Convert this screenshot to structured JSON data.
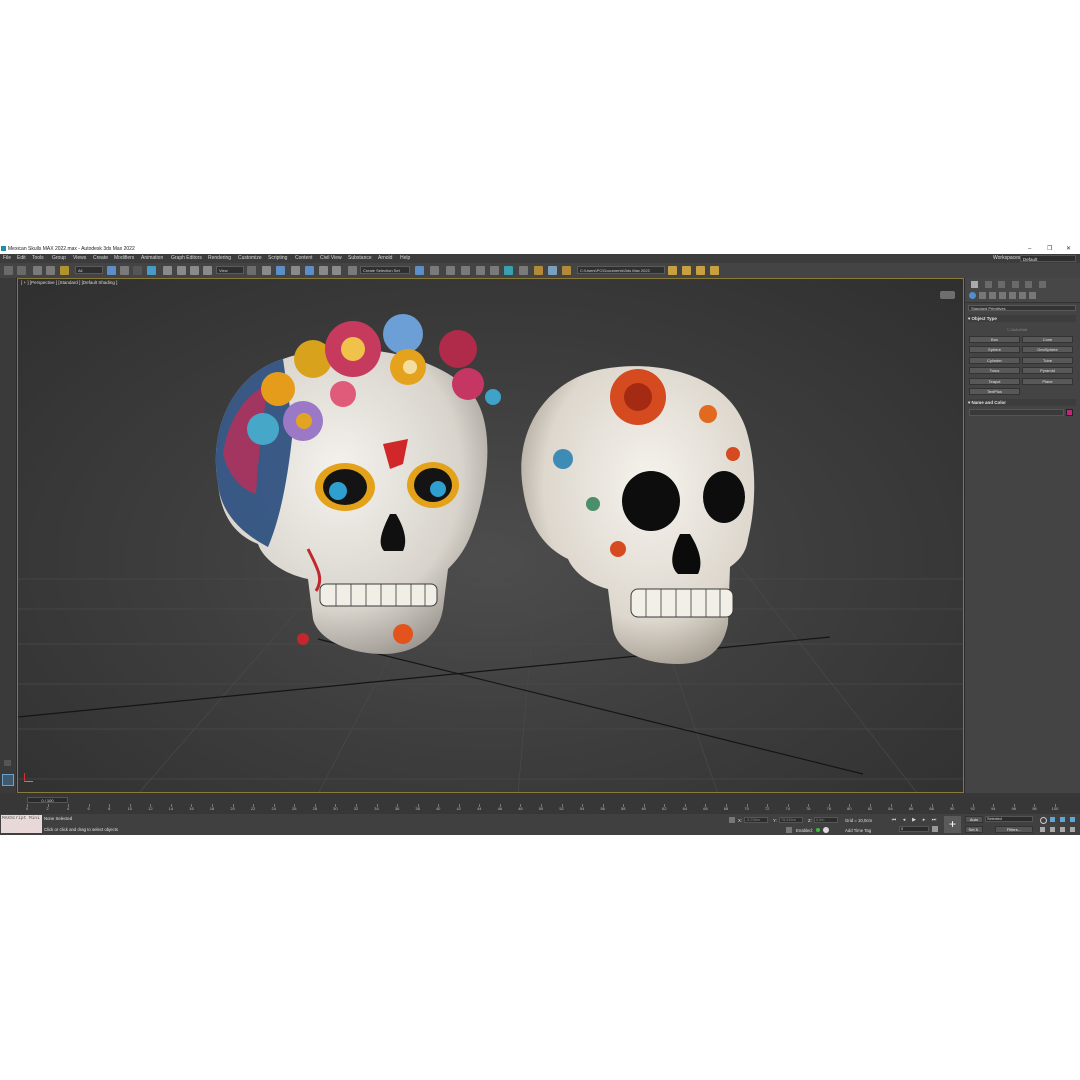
{
  "window": {
    "title": "Mexican Skulls MAX 2022.max - Autodesk 3ds Max 2022",
    "controls": [
      "–",
      "❐",
      "✕"
    ]
  },
  "menu": {
    "items": [
      "File",
      "Edit",
      "Tools",
      "Group",
      "Views",
      "Create",
      "Modifiers",
      "Animation",
      "Graph Editors",
      "Rendering",
      "Customize",
      "Scripting",
      "Content",
      "Civil View",
      "Substance",
      "Arnold",
      "Help"
    ],
    "workspaces_label": "Workspaces:",
    "workspace_value": "Default"
  },
  "toolbar": {
    "filter_value": "All",
    "refcoord_value": "View",
    "selection_set_placeholder": "Create Selection Set",
    "project_path": "C:\\Users\\PC\\Documents\\3ds Max 2022"
  },
  "viewport": {
    "label": "[ + ] [Perspective ] [Standard ] [Default Shading ]"
  },
  "command_panel": {
    "category_value": "Standard Primitives",
    "object_type_title": "Object Type",
    "autogrid_label": "AutoGrid",
    "buttons": [
      "Box",
      "Cone",
      "Sphere",
      "GeoSphere",
      "Cylinder",
      "Tube",
      "Torus",
      "Pyramid",
      "Teapot",
      "Plane",
      "TextPlus"
    ],
    "name_color_title": "Name and Color",
    "object_color": "#c2257e"
  },
  "timeline": {
    "slider_label": "0 / 100",
    "ticks": [
      "0",
      "2",
      "4",
      "6",
      "8",
      "10",
      "12",
      "14",
      "16",
      "18",
      "20",
      "22",
      "24",
      "26",
      "28",
      "30",
      "32",
      "34",
      "36",
      "38",
      "40",
      "42",
      "44",
      "46",
      "48",
      "50",
      "52",
      "54",
      "56",
      "58",
      "60",
      "62",
      "64",
      "66",
      "68",
      "70",
      "72",
      "74",
      "76",
      "78",
      "80",
      "82",
      "84",
      "86",
      "88",
      "90",
      "92",
      "94",
      "96",
      "98",
      "100"
    ]
  },
  "status": {
    "maxscript_label": "MAXScript Mini",
    "selection_status": "None Selected",
    "prompt": "Click or click and drag to select objects",
    "x_label": "X:",
    "x_placeholder": "-5,236m",
    "y_label": "Y:",
    "y_placeholder": "76,916m",
    "z_label": "Z:",
    "z_placeholder": "0,0m",
    "grid_text": "Grid = 10,0cm",
    "enabled_label": "Enabled:",
    "add_time_tag": "Add Time Tag",
    "auto_label": "Auto",
    "selected_value": "Selected",
    "setk_label": "Set K.",
    "filters_label": "Filters...",
    "frame_value": "0"
  }
}
